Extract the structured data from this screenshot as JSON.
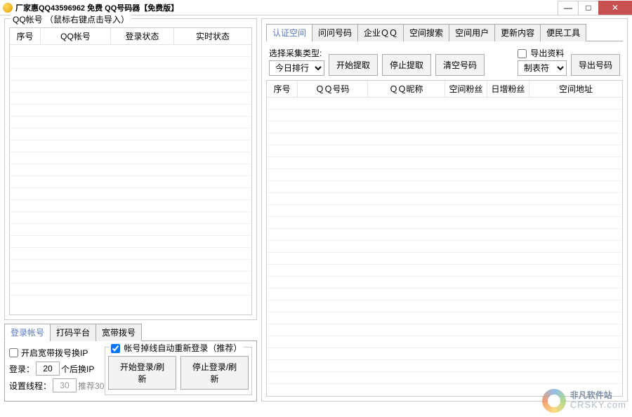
{
  "title": "厂家惠QQ43596962 免费 QQ号码器【免费版】",
  "winbtns": {
    "min": "—",
    "max": "□",
    "close": "✕"
  },
  "left": {
    "legend": "QQ帐号 （鼠标右键点击导入）",
    "headers": [
      "序号",
      "QQ帐号",
      "登录状态",
      "实时状态"
    ],
    "bottom_tabs": [
      "登录帐号",
      "打码平台",
      "宽带拨号"
    ],
    "chk_broadband": "开启宽带拨号换IP",
    "login_label_pre": "登录：",
    "login_value": "20",
    "login_label_post": "个后换IP",
    "thread_label": "设置线程：",
    "thread_value": "30",
    "thread_hint": "推荐30",
    "chk_auto_relogin": "帐号掉线自动重新登录（推荐）",
    "btn_start": "开始登录/刷新",
    "btn_stop": "停止登录/刷新"
  },
  "right": {
    "tabs": [
      "认证空间",
      "问问号码",
      "企业ＱＱ",
      "空间搜索",
      "空间用户",
      "更新内容",
      "便民工具"
    ],
    "collect_label": "选择采集类型:",
    "collect_select": "今日排行",
    "btn_start": "开始提取",
    "btn_stop": "停止提取",
    "btn_clear": "清空号码",
    "chk_export": "导出资料",
    "export_select": "制表符",
    "btn_export": "导出号码",
    "headers": [
      "序号",
      "ＱＱ号码",
      "ＱＱ昵称",
      "空间粉丝",
      "日增粉丝",
      "空间地址"
    ]
  },
  "watermark": {
    "l1": "非凡软件站",
    "l2": "CRSKY.com"
  }
}
